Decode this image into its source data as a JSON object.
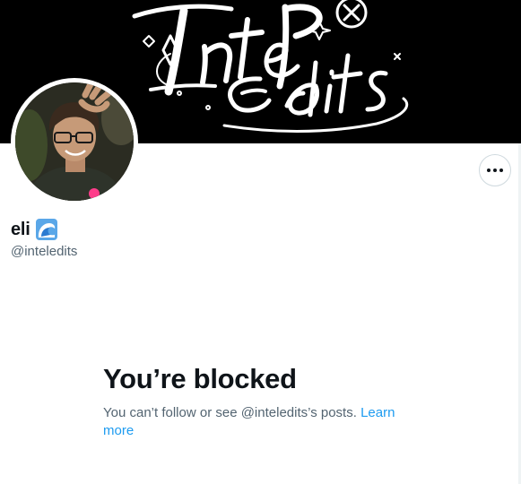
{
  "colors": {
    "banner_bg": "#000000",
    "text_primary": "#0f1419",
    "text_secondary": "#536471",
    "link": "#1d9bf0",
    "border": "#cfd9de"
  },
  "banner": {
    "logo_text": "InteEdits",
    "logo_icons": [
      "diamond-sparkle",
      "star-circle"
    ]
  },
  "profile": {
    "display_name": "eli",
    "badge_icon": "wave-icon",
    "handle": "@inteledits",
    "more_icon": "more-horizontal-icon"
  },
  "blocked": {
    "title": "You’re blocked",
    "description": "You can’t follow or see @inteledits’s posts.",
    "link_text": "Learn more"
  }
}
